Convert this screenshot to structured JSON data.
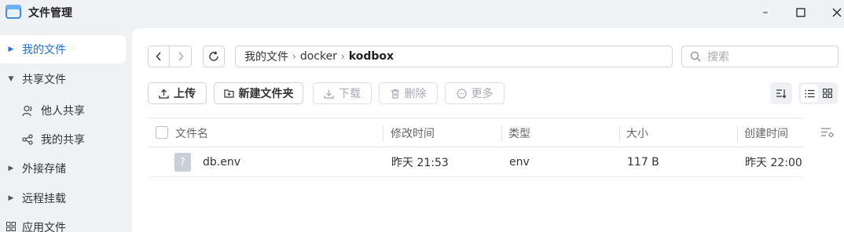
{
  "app": {
    "title": "文件管理"
  },
  "window_controls": {
    "minimize": "–",
    "maximize": "☐",
    "close": "✕"
  },
  "sidebar": {
    "items": [
      {
        "label": "我的文件",
        "caret": "▶"
      },
      {
        "label": "共享文件",
        "caret": "▼"
      },
      {
        "label": "他人共享"
      },
      {
        "label": "我的共享"
      },
      {
        "label": "外接存储",
        "caret": "▶"
      },
      {
        "label": "远程挂载",
        "caret": "▶"
      },
      {
        "label": "应用文件"
      }
    ]
  },
  "breadcrumb": {
    "parts": [
      "我的文件",
      "docker",
      "kodbox"
    ],
    "sep": "›"
  },
  "search": {
    "placeholder": "搜索"
  },
  "toolbar": {
    "upload": "上传",
    "new_folder": "新建文件夹",
    "download": "下载",
    "delete": "删除",
    "more": "更多"
  },
  "table": {
    "columns": [
      "文件名",
      "修改时间",
      "类型",
      "大小",
      "创建时间"
    ],
    "rows": [
      {
        "name": "db.env",
        "modified": "昨天 21:53",
        "type": "env",
        "size": "117 B",
        "created": "昨天 22:00",
        "icon_glyph": "?"
      }
    ]
  },
  "colors": {
    "accent": "#1f6fd6",
    "panel": "#ffffff",
    "background": "#f0f1f4"
  }
}
